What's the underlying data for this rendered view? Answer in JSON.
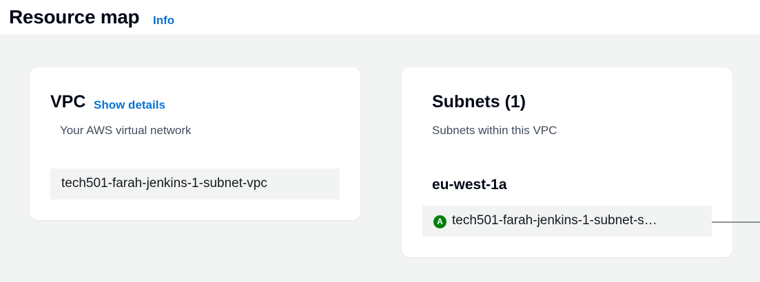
{
  "header": {
    "title": "Resource map",
    "info_label": "Info"
  },
  "vpc": {
    "title": "VPC",
    "show_details_label": "Show details",
    "description": "Your AWS virtual network",
    "name": "tech501-farah-jenkins-1-subnet-vpc"
  },
  "subnets": {
    "title": "Subnets (1)",
    "description": "Subnets within this VPC",
    "availability_zones": [
      {
        "name": "eu-west-1a",
        "items": [
          {
            "badge": "A",
            "badge_color": "#037f0c",
            "name": "tech501-farah-jenkins-1-subnet-s…"
          }
        ]
      }
    ]
  },
  "colors": {
    "link": "#0972d3",
    "map_background": "#f2f3f3",
    "connector": "#8d9096"
  }
}
